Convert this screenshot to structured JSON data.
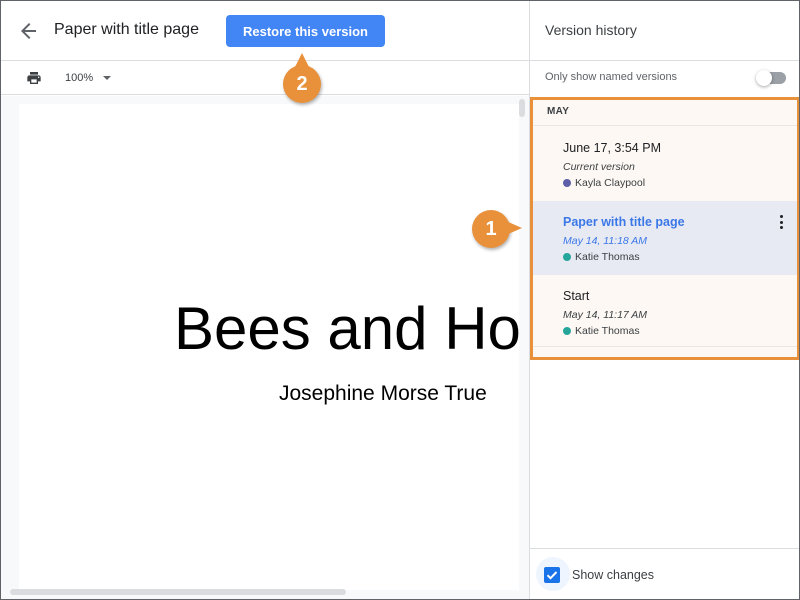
{
  "header": {
    "back_icon": "arrow-left-icon",
    "doc_title": "Paper with title page",
    "restore_button": "Restore this version"
  },
  "toolbar": {
    "print_icon": "print-icon",
    "zoom": "100%"
  },
  "document": {
    "heading": "Bees and Hor",
    "author": "Josephine Morse True"
  },
  "panel": {
    "title": "Version history",
    "named_toggle_label": "Only show named versions",
    "named_toggle_on": false,
    "month": "MAY",
    "versions": [
      {
        "title": "June 17, 3:54 PM",
        "subtitle": "Current version",
        "user": "Kayla Claypool",
        "user_color": "#5c5fa8",
        "selected": false
      },
      {
        "title": "Paper with title page",
        "subtitle": "May 14, 11:18 AM",
        "user": "Katie Thomas",
        "user_color": "#26a69a",
        "selected": true
      },
      {
        "title": "Start",
        "subtitle": "May 14, 11:17 AM",
        "user": "Katie Thomas",
        "user_color": "#26a69a",
        "selected": false
      }
    ],
    "show_changes_label": "Show changes",
    "show_changes_checked": true
  },
  "callouts": {
    "first": "1",
    "second": "2"
  },
  "colors": {
    "accent": "#4285f4",
    "callout": "#e8903a",
    "selected_bg": "#e8eaf3"
  }
}
